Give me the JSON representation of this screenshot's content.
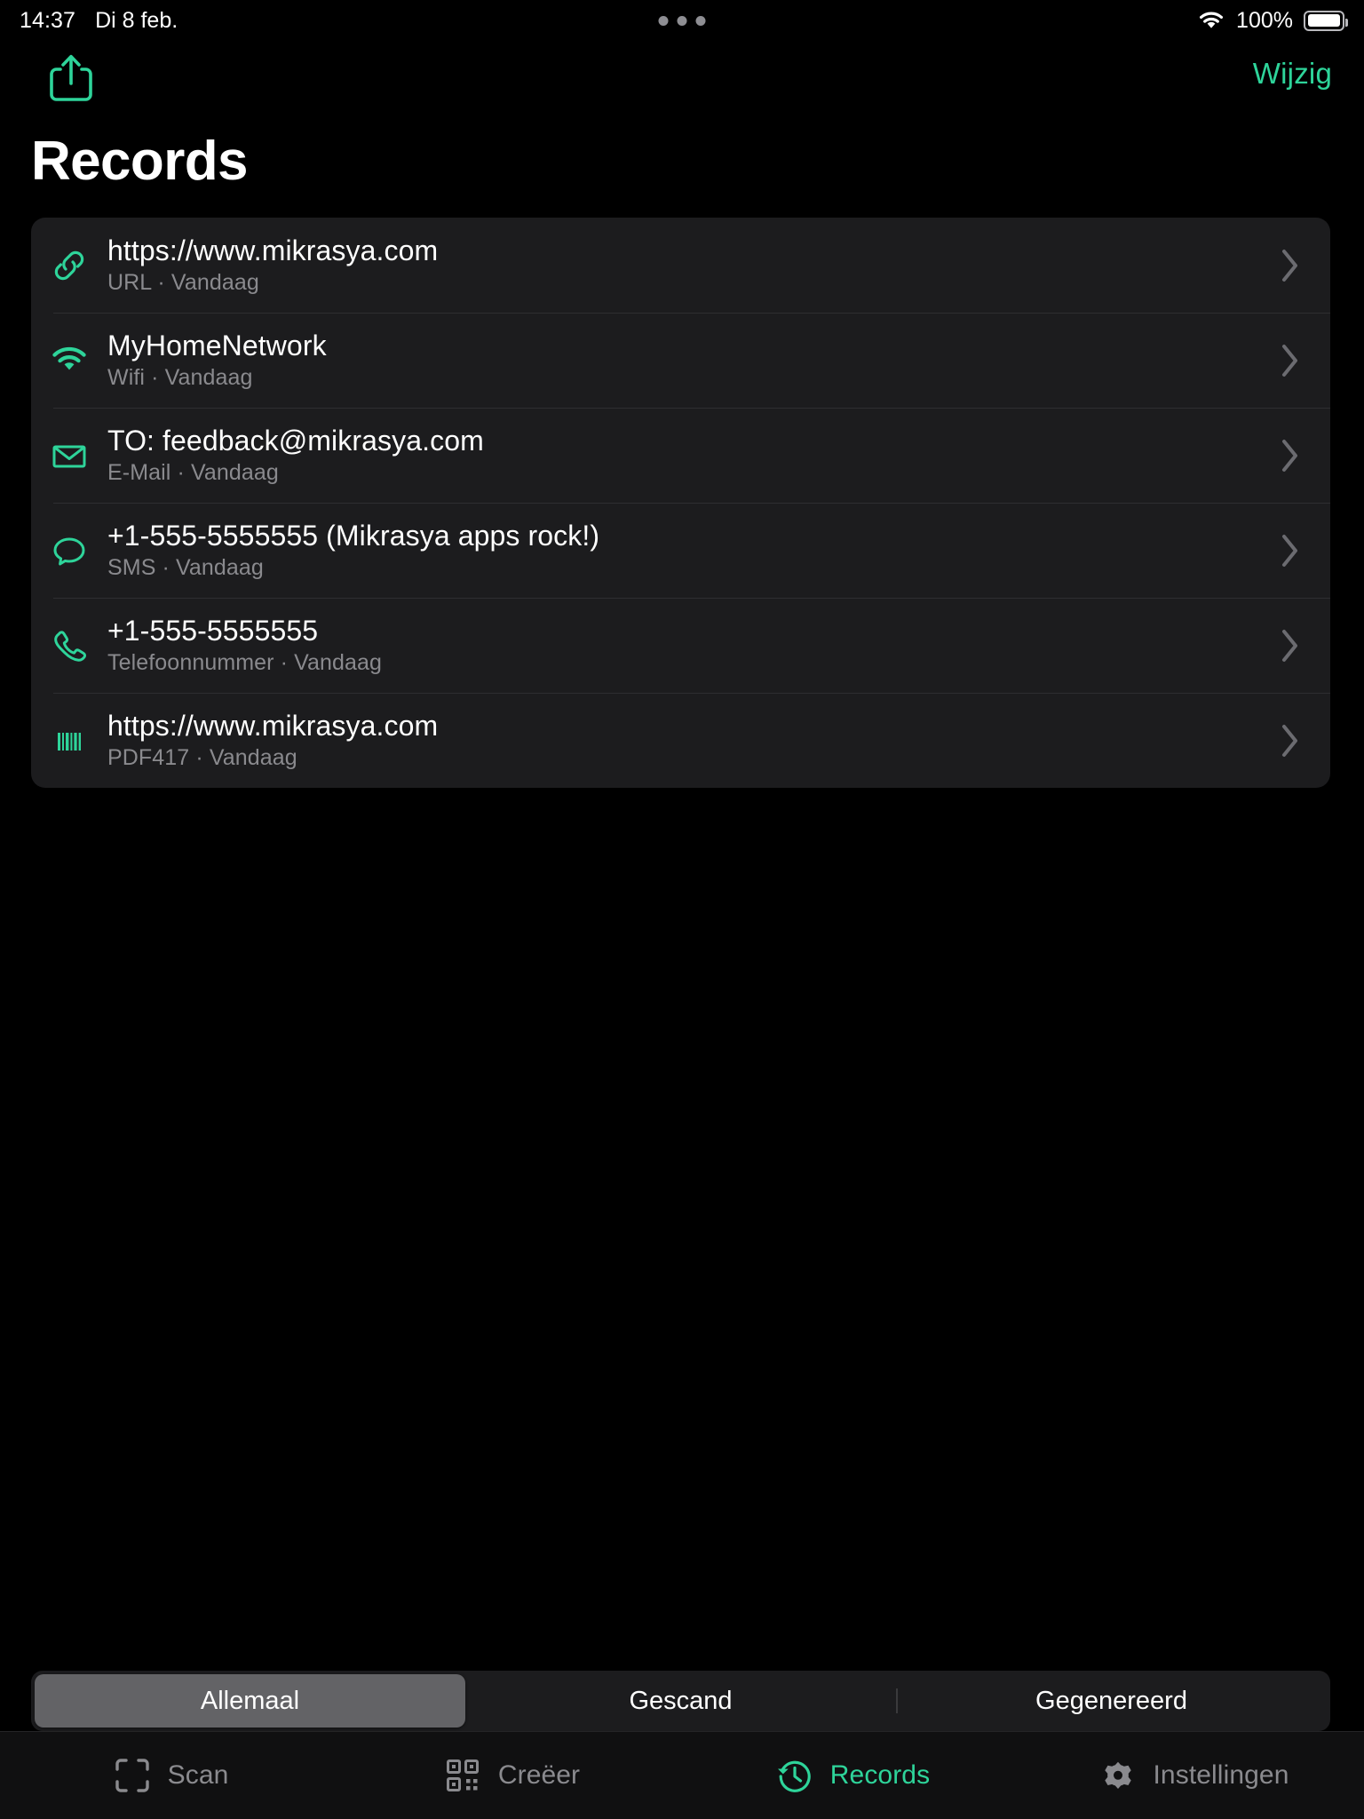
{
  "status_bar": {
    "time": "14:37",
    "date": "Di 8 feb.",
    "battery_percent": "100%",
    "wifi_icon": "wifi-icon",
    "battery_icon": "battery-full-icon",
    "multitask_icon": "multitasking-dots-icon"
  },
  "nav": {
    "share_icon": "share-icon",
    "edit_label": "Wijzig"
  },
  "header": {
    "title": "Records"
  },
  "colors": {
    "accent": "#2ed49a",
    "background": "#000000",
    "card": "#1c1c1e",
    "separator": "#2e2e31",
    "secondary_text": "#8a8a8e",
    "segment_selected": "#636366"
  },
  "records": [
    {
      "title": "https://www.mikrasya.com",
      "subtitle": "URL · Vandaag",
      "type": "URL",
      "date": "Vandaag",
      "icon": "link-icon"
    },
    {
      "title": "MyHomeNetwork",
      "subtitle": "Wifi · Vandaag",
      "type": "Wifi",
      "date": "Vandaag",
      "icon": "wifi-icon"
    },
    {
      "title": "TO: feedback@mikrasya.com",
      "subtitle": "E-Mail · Vandaag",
      "type": "E-Mail",
      "date": "Vandaag",
      "icon": "envelope-icon"
    },
    {
      "title": "+1-555-5555555 (Mikrasya apps rock!)",
      "subtitle": "SMS · Vandaag",
      "type": "SMS",
      "date": "Vandaag",
      "icon": "speech-bubble-icon"
    },
    {
      "title": "+1-555-5555555",
      "subtitle": "Telefoonnummer · Vandaag",
      "type": "Telefoonnummer",
      "date": "Vandaag",
      "icon": "phone-icon"
    },
    {
      "title": "https://www.mikrasya.com",
      "subtitle": "PDF417 · Vandaag",
      "type": "PDF417",
      "date": "Vandaag",
      "icon": "barcode-icon"
    }
  ],
  "segments": [
    {
      "label": "Allemaal",
      "selected": true
    },
    {
      "label": "Gescand",
      "selected": false
    },
    {
      "label": "Gegenereerd",
      "selected": false
    }
  ],
  "tabs": [
    {
      "label": "Scan",
      "icon": "viewfinder-icon",
      "active": false
    },
    {
      "label": "Creëer",
      "icon": "qr-code-icon",
      "active": false
    },
    {
      "label": "Records",
      "icon": "clock-history-icon",
      "active": true
    },
    {
      "label": "Instellingen",
      "icon": "gear-icon",
      "active": false
    }
  ]
}
